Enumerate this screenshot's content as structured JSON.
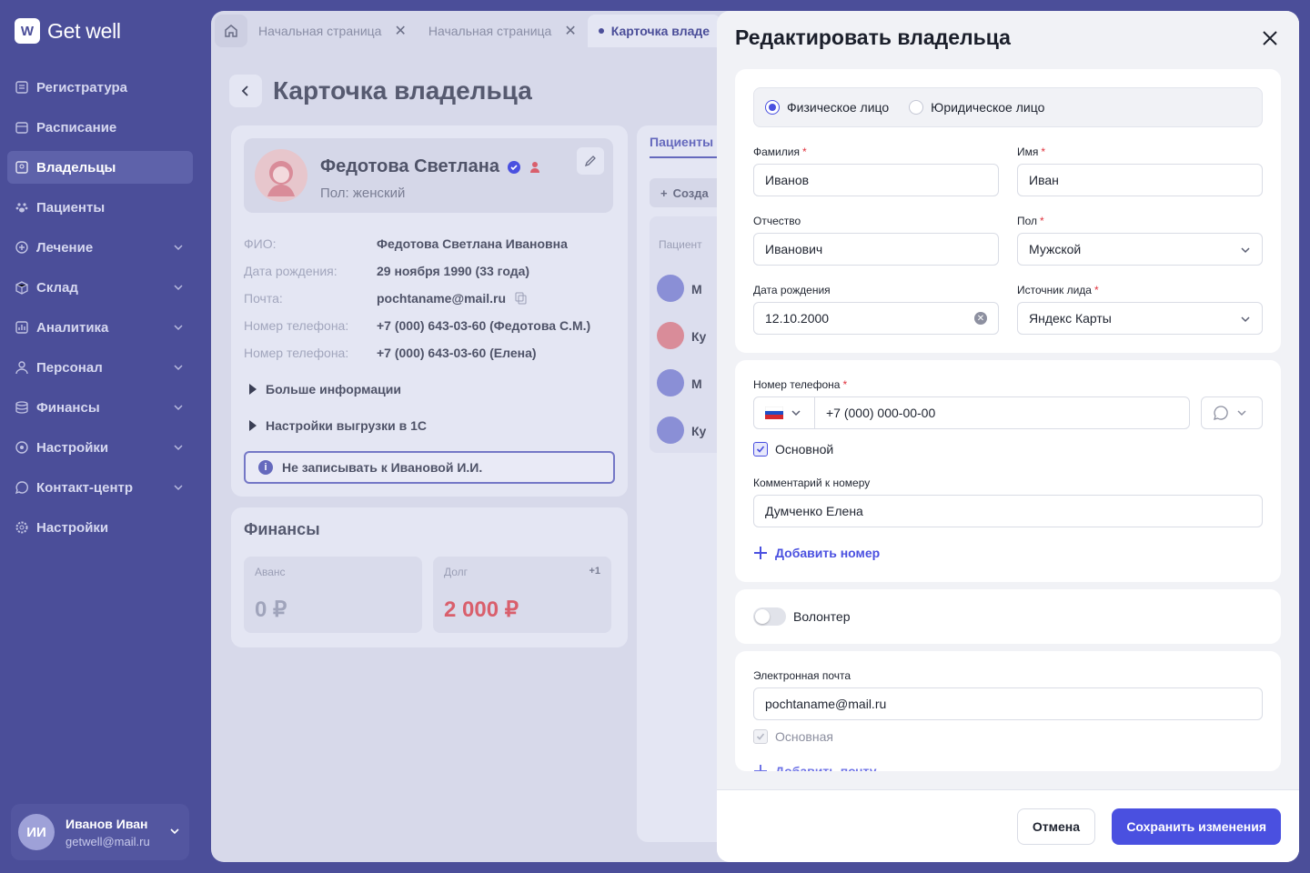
{
  "app": {
    "logo_mark": "W",
    "logo_text": "Get well"
  },
  "sidebar": {
    "items": [
      {
        "label": "Регистратура",
        "icon": "register-icon",
        "has_children": false
      },
      {
        "label": "Расписание",
        "icon": "calendar-icon",
        "has_children": false
      },
      {
        "label": "Владельцы",
        "icon": "owners-icon",
        "has_children": false,
        "active": true
      },
      {
        "label": "Пациенты",
        "icon": "paw-icon",
        "has_children": false
      },
      {
        "label": "Лечение",
        "icon": "treatment-icon",
        "has_children": true
      },
      {
        "label": "Склад",
        "icon": "box-icon",
        "has_children": true
      },
      {
        "label": "Аналитика",
        "icon": "analytics-icon",
        "has_children": true
      },
      {
        "label": "Персонал",
        "icon": "person-icon",
        "has_children": true
      },
      {
        "label": "Финансы",
        "icon": "coins-icon",
        "has_children": true
      },
      {
        "label": "Настройки",
        "icon": "settings-icon",
        "has_children": true
      },
      {
        "label": "Контакт-центр",
        "icon": "chat-icon",
        "has_children": true
      },
      {
        "label": "Настройки",
        "icon": "gear-icon",
        "has_children": false
      }
    ],
    "user": {
      "initials": "ИИ",
      "name": "Иванов Иван",
      "email": "getwell@mail.ru"
    }
  },
  "tabs": [
    {
      "label": "Начальная страница",
      "active": false
    },
    {
      "label": "Начальная страница",
      "active": false
    },
    {
      "label": "Карточка владе",
      "active": true
    }
  ],
  "page": {
    "title": "Карточка владельца",
    "owner": {
      "name": "Федотова Светлана",
      "sex": "Пол: женский"
    },
    "info": [
      {
        "k": "ФИО:",
        "v": "Федотова Светлана Ивановна"
      },
      {
        "k": "Дата рождения:",
        "v": "29 ноября 1990 (33 года)"
      },
      {
        "k": "Почта:",
        "v": "pochtaname@mail.ru"
      },
      {
        "k": "Номер телефона:",
        "v": "+7 (000) 643-03-60 (Федотова С.М.)"
      },
      {
        "k": "Номер телефона:",
        "v": "+7 (000) 643-03-60 (Елена)"
      }
    ],
    "expanders": [
      "Больше информации",
      "Настройки выгрузки в 1С"
    ],
    "warning": "Не записывать к Ивановой И.И.",
    "finance": {
      "title": "Финансы",
      "advance_label": "Аванс",
      "advance_value": "0 ₽",
      "debt_label": "Долг",
      "debt_value": "2 000 ₽",
      "debt_badge": "+1"
    },
    "patients": {
      "tab": "Пациенты",
      "create": "Созда",
      "header": "Пациент",
      "rows": [
        "М",
        "Ку",
        "М",
        "Ку"
      ]
    }
  },
  "modal": {
    "title": "Редактировать владельца",
    "person_type": {
      "physical": "Физическое лицо",
      "legal": "Юридическое лицо",
      "selected": "physical"
    },
    "fields": {
      "last_name": {
        "label": "Фамилия",
        "value": "Иванов"
      },
      "first_name": {
        "label": "Имя",
        "value": "Иван"
      },
      "patronymic": {
        "label": "Отчество",
        "value": "Иванович"
      },
      "sex": {
        "label": "Пол",
        "value": "Мужской"
      },
      "birth_date": {
        "label": "Дата рождения",
        "value": "12.10.2000"
      },
      "lead_source": {
        "label": "Источник лида",
        "value": "Яндекс Карты"
      }
    },
    "phone": {
      "label": "Номер телефона",
      "value": "+7 (000) 000-00-00",
      "main_label": "Основной",
      "comment_label": "Комментарий к номеру",
      "comment_value": "Думченко Елена",
      "add_label": "Добавить номер"
    },
    "volunteer": {
      "label": "Волонтер",
      "on": false
    },
    "email": {
      "label": "Электронная почта",
      "value": "pochtaname@mail.ru",
      "main_label": "Основная",
      "add_label": "Добавить почту"
    },
    "footer": {
      "cancel": "Отмена",
      "save": "Сохранить изменения"
    }
  },
  "colors": {
    "brand": "#4b4e99",
    "accent": "#4a50e0",
    "required": "#e0343f",
    "debt": "#d95f6c"
  }
}
